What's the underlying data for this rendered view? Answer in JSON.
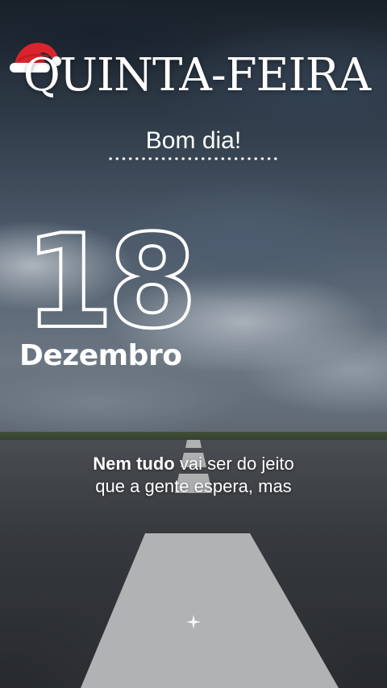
{
  "day_title": "QUINTA-FEIRA",
  "greeting": "Bom dia!",
  "date": {
    "day": "18",
    "month": "Dezembro"
  },
  "quote": {
    "bold": "Nem tudo",
    "rest_line1": " vai ser do jeito",
    "line2": "que a gente espera, mas"
  },
  "icons": {
    "hat": "santa-hat-icon",
    "sparkle": "sparkle-icon"
  },
  "colors": {
    "text": "#ffffff",
    "hat_red": "#d9242b"
  }
}
